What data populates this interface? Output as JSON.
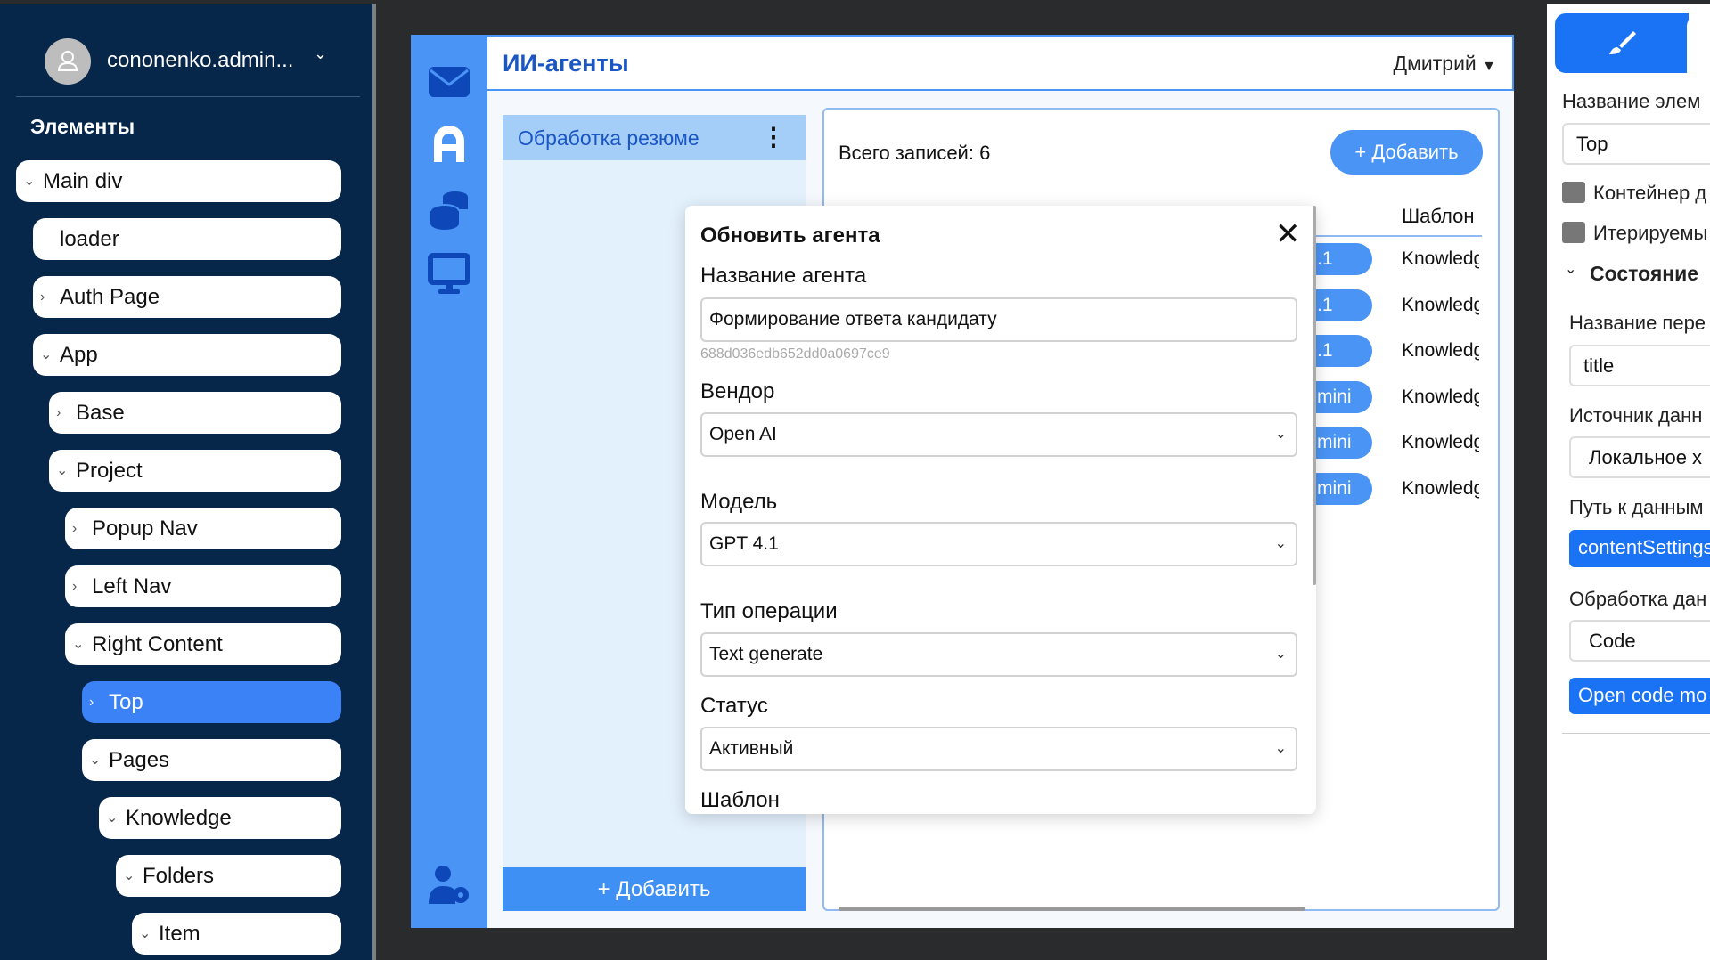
{
  "sidebar": {
    "username": "cononenko.admin...",
    "section_title": "Элементы",
    "tree": [
      {
        "label": "Main div",
        "chev": "v"
      },
      {
        "label": "loader",
        "chev": ""
      },
      {
        "label": "Auth Page",
        "chev": ">"
      },
      {
        "label": "App",
        "chev": "v"
      },
      {
        "label": "Base",
        "chev": ">"
      },
      {
        "label": "Project",
        "chev": "v"
      },
      {
        "label": "Popup Nav",
        "chev": ">"
      },
      {
        "label": "Left Nav",
        "chev": ">"
      },
      {
        "label": "Right Content",
        "chev": "v"
      },
      {
        "label": "Top",
        "chev": ">"
      },
      {
        "label": "Pages",
        "chev": "v"
      },
      {
        "label": "Knowledge",
        "chev": "v"
      },
      {
        "label": "Folders",
        "chev": "v"
      },
      {
        "label": "Item",
        "chev": "v"
      }
    ]
  },
  "header": {
    "title": "ИИ-агенты",
    "user": "Дмитрий"
  },
  "list": {
    "items": [
      {
        "label": "Обработка резюме"
      }
    ],
    "add_label": "+ Добавить"
  },
  "content": {
    "total": "Всего записей: 6",
    "add_label": "+ Добавить",
    "col_template": "Шаблон",
    "rows": [
      {
        "model": ".1",
        "template": "Knowledge"
      },
      {
        "model": ".1",
        "template": "Knowledge"
      },
      {
        "model": ".1",
        "template": "Knowledge"
      },
      {
        "model": "mini",
        "template": "Knowledge"
      },
      {
        "model": "mini",
        "template": "Knowledge"
      },
      {
        "model": "mini",
        "template": "Knowledge"
      }
    ]
  },
  "modal": {
    "title": "Обновить агента",
    "name_label": "Название агента",
    "name_value": "Формирование ответа кандидату",
    "id": "688d036edb652dd0a0697ce9",
    "vendor_label": "Вендор",
    "vendor_value": "Open AI",
    "model_label": "Модель",
    "model_value": "GPT 4.1",
    "op_label": "Тип операции",
    "op_value": "Text generate",
    "status_label": "Статус",
    "status_value": "Активный",
    "template_label": "Шаблон"
  },
  "rpanel": {
    "el_name_label": "Название элем",
    "el_name_value": "Top",
    "cb1": "Контейнер д",
    "cb2": "Итерируемы",
    "state": "Состояние",
    "var_label": "Название пере",
    "var_value": "title",
    "src_label": "Источник данн",
    "src_value": "Локальное х",
    "path_label": "Путь к данным",
    "path_value": "contentSettings",
    "proc_label": "Обработка дан",
    "proc_value": "Code",
    "open_code": "Open code mo"
  },
  "colors": {
    "accent": "#4a94f5",
    "sidebar": "#06264a"
  }
}
